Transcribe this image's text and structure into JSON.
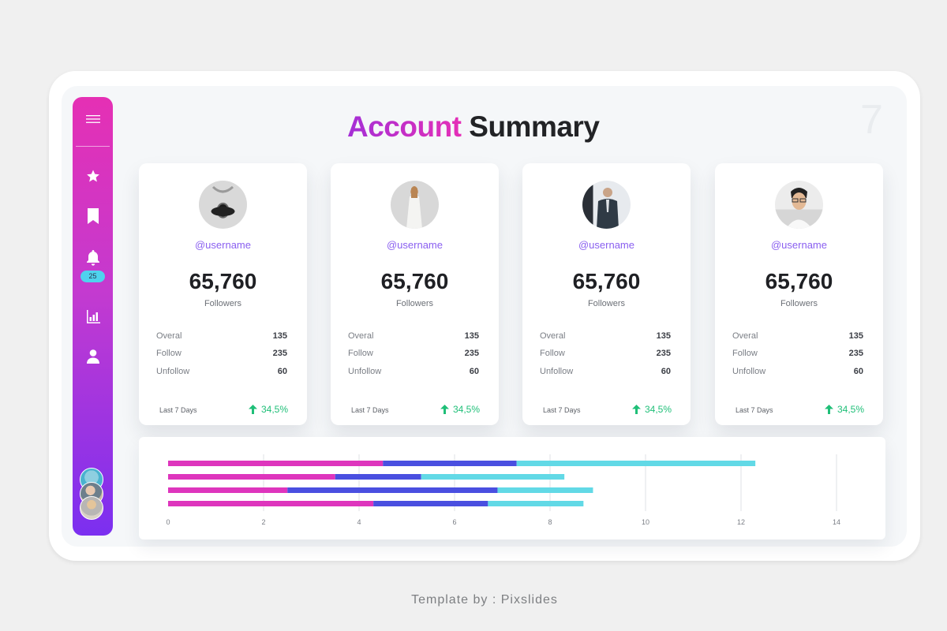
{
  "page_number": "7",
  "title": {
    "part1": "Account",
    "part2": "Summary"
  },
  "sidebar": {
    "items": [
      {
        "icon": "menu-icon"
      },
      {
        "icon": "star-icon"
      },
      {
        "icon": "bookmark-icon"
      },
      {
        "icon": "bell-icon",
        "badge": "25"
      },
      {
        "icon": "chart-icon"
      },
      {
        "icon": "user-icon"
      }
    ]
  },
  "cards": [
    {
      "username": "@username",
      "followers_count": "65,760",
      "followers_label": "Followers",
      "stats": [
        {
          "label": "Overal",
          "value": "135"
        },
        {
          "label": "Follow",
          "value": "235"
        },
        {
          "label": "Unfollow",
          "value": "60"
        }
      ],
      "period": "Last 7 Days",
      "change": "34,5%"
    },
    {
      "username": "@username",
      "followers_count": "65,760",
      "followers_label": "Followers",
      "stats": [
        {
          "label": "Overal",
          "value": "135"
        },
        {
          "label": "Follow",
          "value": "235"
        },
        {
          "label": "Unfollow",
          "value": "60"
        }
      ],
      "period": "Last 7 Days",
      "change": "34,5%"
    },
    {
      "username": "@username",
      "followers_count": "65,760",
      "followers_label": "Followers",
      "stats": [
        {
          "label": "Overal",
          "value": "135"
        },
        {
          "label": "Follow",
          "value": "235"
        },
        {
          "label": "Unfollow",
          "value": "60"
        }
      ],
      "period": "Last 7 Days",
      "change": "34,5%"
    },
    {
      "username": "@username",
      "followers_count": "65,760",
      "followers_label": "Followers",
      "stats": [
        {
          "label": "Overal",
          "value": "135"
        },
        {
          "label": "Follow",
          "value": "235"
        },
        {
          "label": "Unfollow",
          "value": "60"
        }
      ],
      "period": "Last 7 Days",
      "change": "34,5%"
    }
  ],
  "colors": {
    "accent_magenta": "#e030b8",
    "accent_purple": "#7b2ff0",
    "series_1": "#de35bd",
    "series_2": "#4a4fe0",
    "series_3": "#62d9e6",
    "positive": "#1fbf78"
  },
  "chart_data": {
    "type": "bar",
    "orientation": "horizontal",
    "stacked": true,
    "categories": [
      "",
      "",
      "",
      ""
    ],
    "series": [
      {
        "values": [
          4.5,
          3.5,
          2.5,
          4.3
        ]
      },
      {
        "values": [
          2.8,
          1.8,
          4.4,
          2.4
        ]
      },
      {
        "values": [
          5.0,
          3.0,
          2.0,
          2.0
        ]
      }
    ],
    "xlim": [
      0,
      14
    ],
    "x_ticks": [
      "0",
      "2",
      "4",
      "6",
      "8",
      "10",
      "12",
      "14"
    ],
    "grid": true
  },
  "credit": "Template by : Pixslides"
}
